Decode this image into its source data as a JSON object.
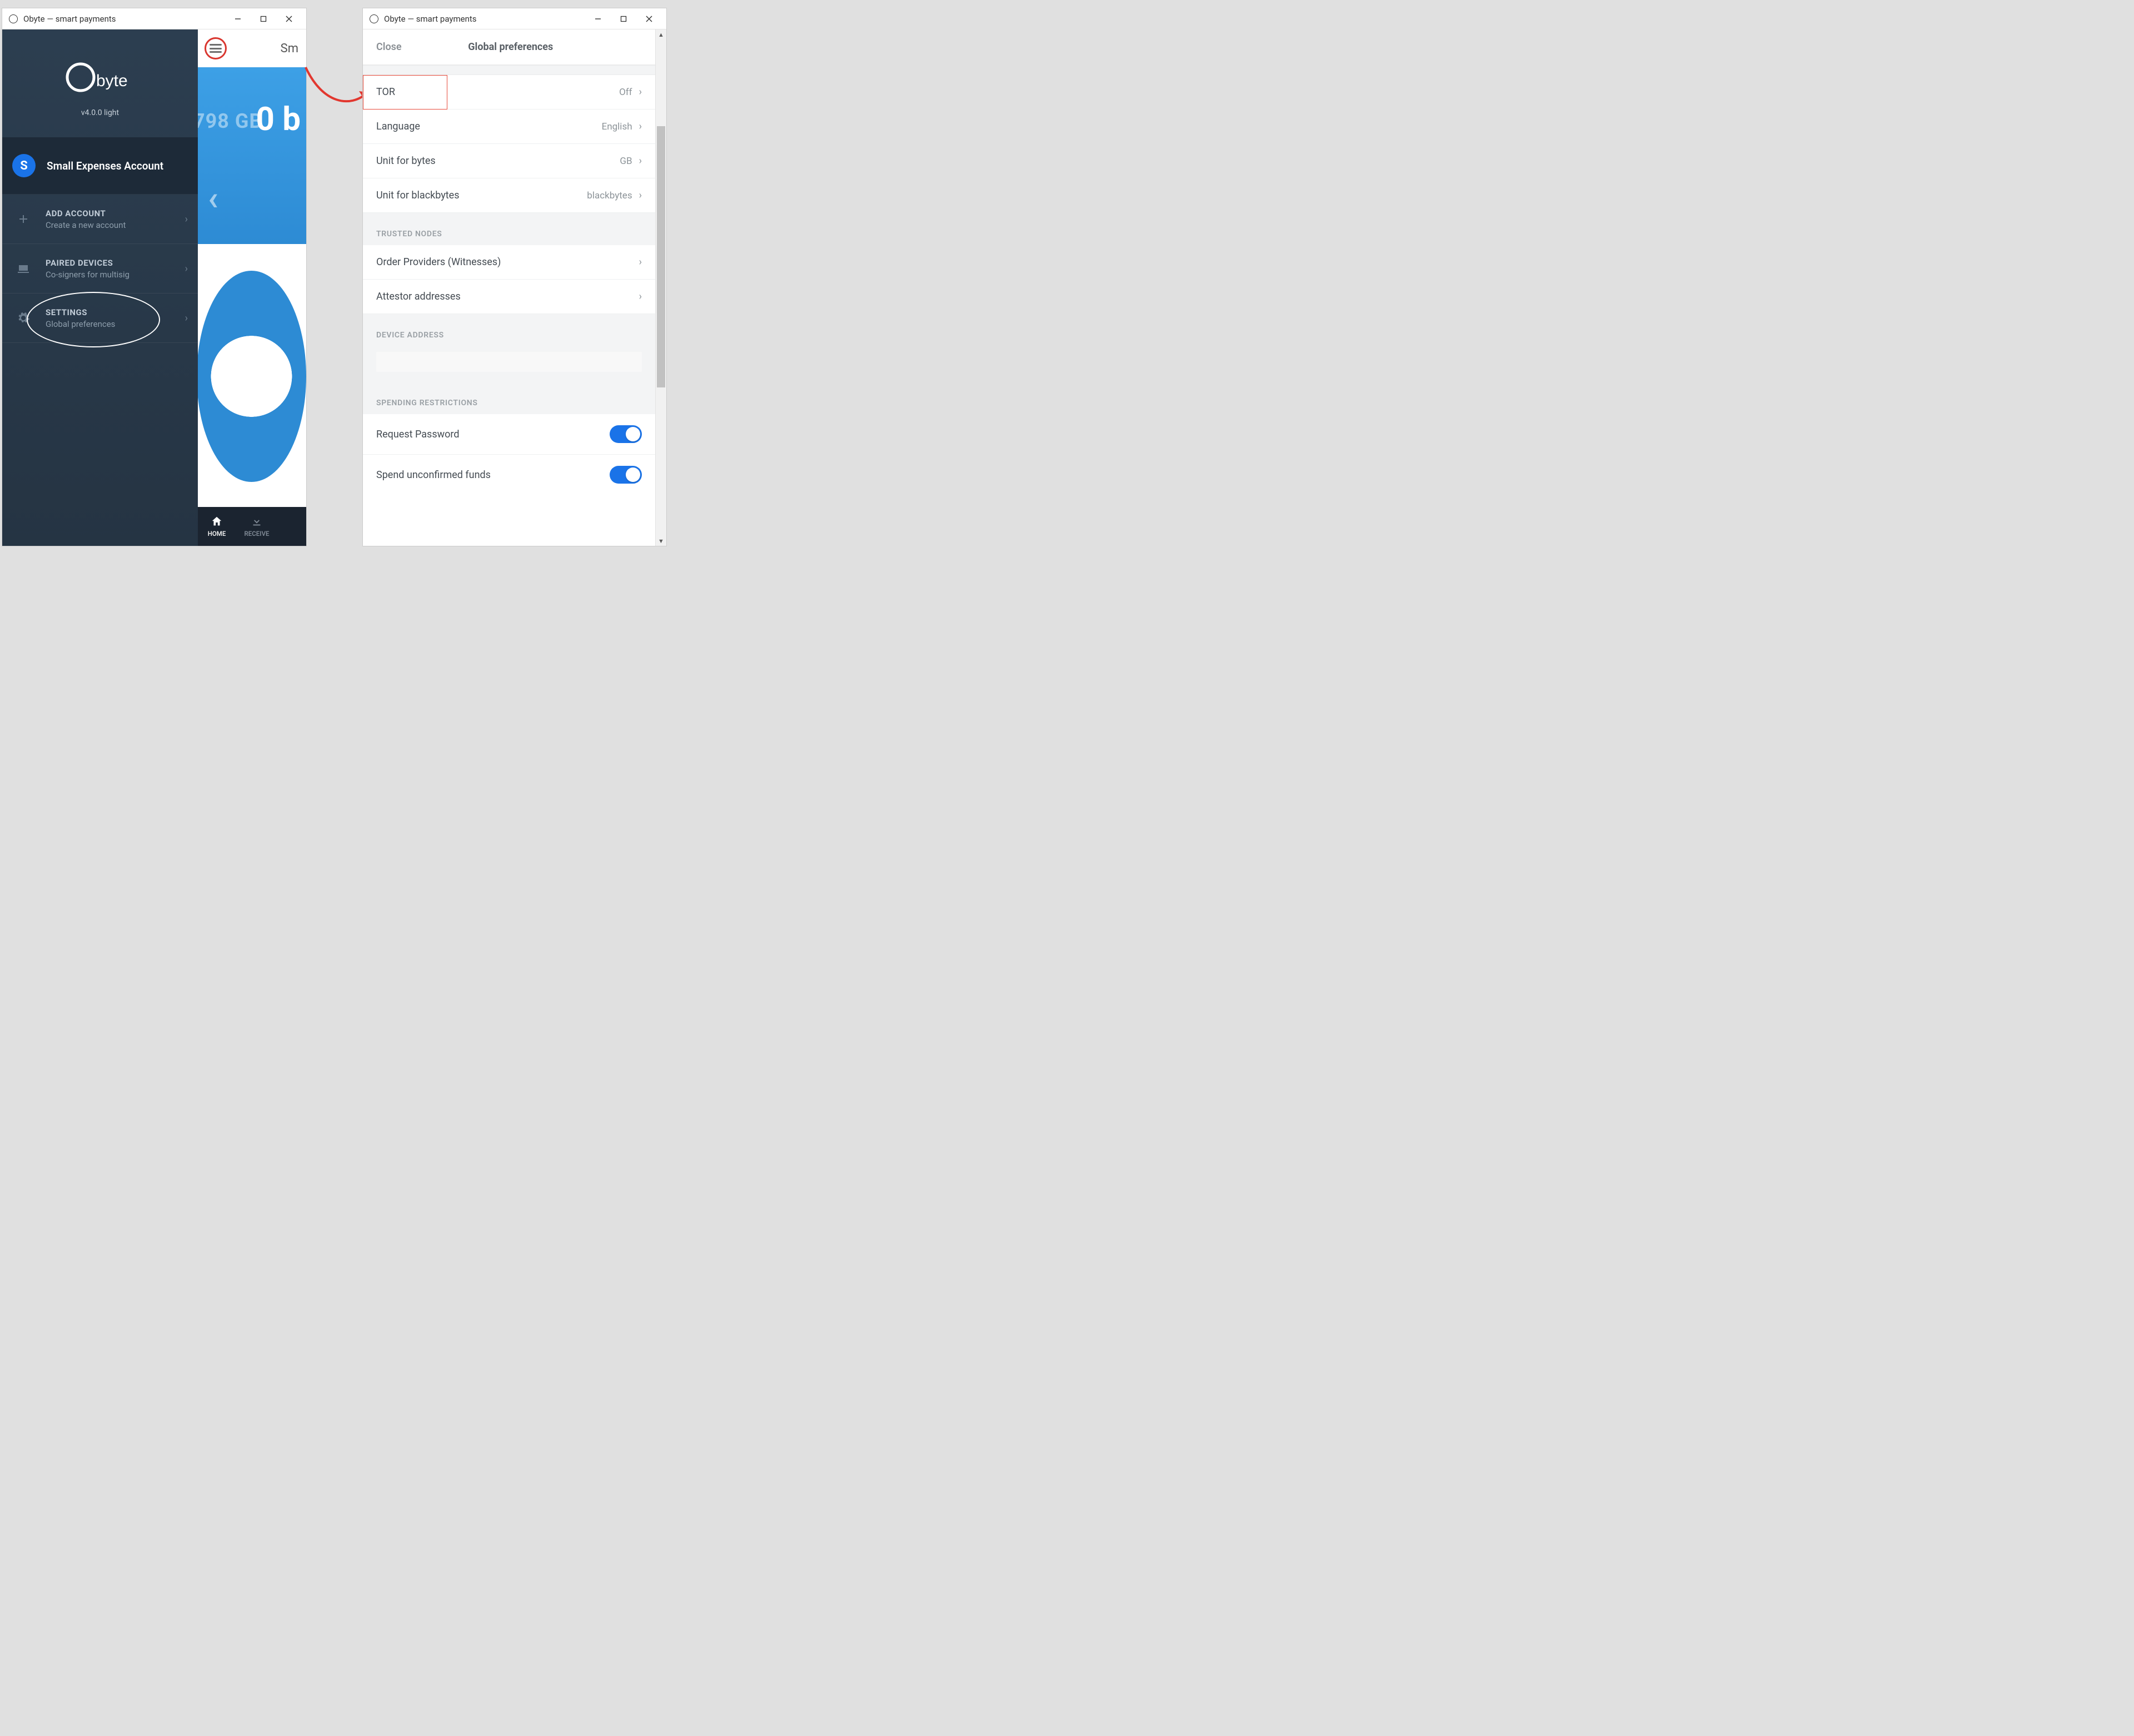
{
  "app_title": "Obyte — smart payments",
  "left": {
    "version": "v4.0.0 light",
    "account": {
      "badge": "S",
      "name": "Small Expenses Account"
    },
    "items": {
      "add": {
        "title": "ADD ACCOUNT",
        "sub": "Create a new account"
      },
      "paired": {
        "title": "PAIRED DEVICES",
        "sub": "Co-signers for multisig"
      },
      "settings": {
        "title": "SETTINGS",
        "sub": "Global preferences"
      }
    },
    "behind": {
      "header_peek": "Sm",
      "gb_faint": "798 GB",
      "balance": "0 b"
    },
    "tabs": {
      "home": "HOME",
      "receive": "RECEIVE"
    }
  },
  "right": {
    "close": "Close",
    "title": "Global preferences",
    "rows": {
      "tor": {
        "label": "TOR",
        "value": "Off"
      },
      "language": {
        "label": "Language",
        "value": "English"
      },
      "unit_bytes": {
        "label": "Unit for bytes",
        "value": "GB"
      },
      "unit_black": {
        "label": "Unit for blackbytes",
        "value": "blackbytes"
      },
      "witnesses": {
        "label": "Order Providers (Witnesses)"
      },
      "attestors": {
        "label": "Attestor addresses"
      },
      "req_pw": {
        "label": "Request Password"
      },
      "spend_unc": {
        "label": "Spend unconfirmed funds"
      }
    },
    "sections": {
      "trusted": "TRUSTED NODES",
      "devaddr": "DEVICE ADDRESS",
      "spending": "SPENDING RESTRICTIONS"
    }
  }
}
